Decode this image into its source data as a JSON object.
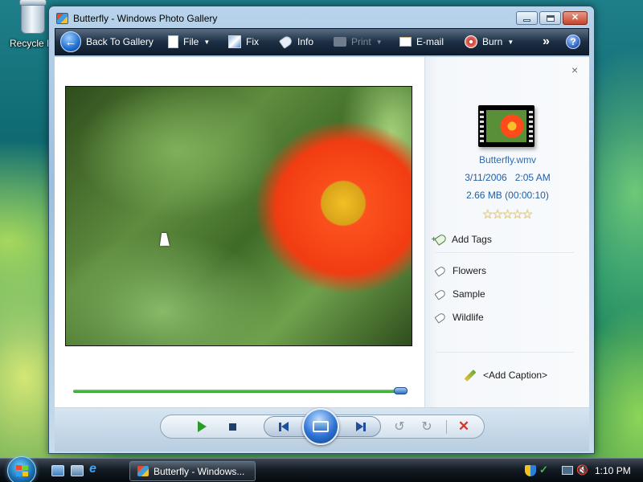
{
  "desktop": {
    "recycle_bin_label": "Recycle B"
  },
  "window": {
    "title": "Butterfly - Windows Photo Gallery"
  },
  "toolbar": {
    "back_label": "Back To Gallery",
    "file_label": "File",
    "fix_label": "Fix",
    "info_label": "Info",
    "print_label": "Print",
    "email_label": "E-mail",
    "burn_label": "Burn",
    "more_label": "»",
    "help_label": "?"
  },
  "playback": {
    "progress": 0.98
  },
  "info_pane": {
    "close_label": "×",
    "file_name": "Butterfly.wmv",
    "date_time": "3/11/2006   2:05 AM",
    "size_duration": "2.66 MB (00:00:10)",
    "rating": 0,
    "rating_max": 5,
    "add_tags_label": "Add Tags",
    "tags": [
      "Flowers",
      "Sample",
      "Wildlife"
    ],
    "add_caption_label": "<Add Caption>"
  },
  "taskbar": {
    "task_label": "Butterfly - Windows...",
    "clock": "1:10 PM"
  },
  "icons": {
    "back": "back-arrow-icon",
    "file": "document-icon",
    "fix": "fix-icon",
    "info": "tag-icon",
    "print": "printer-icon",
    "email": "email-icon",
    "burn": "disc-icon",
    "help": "help-icon"
  }
}
